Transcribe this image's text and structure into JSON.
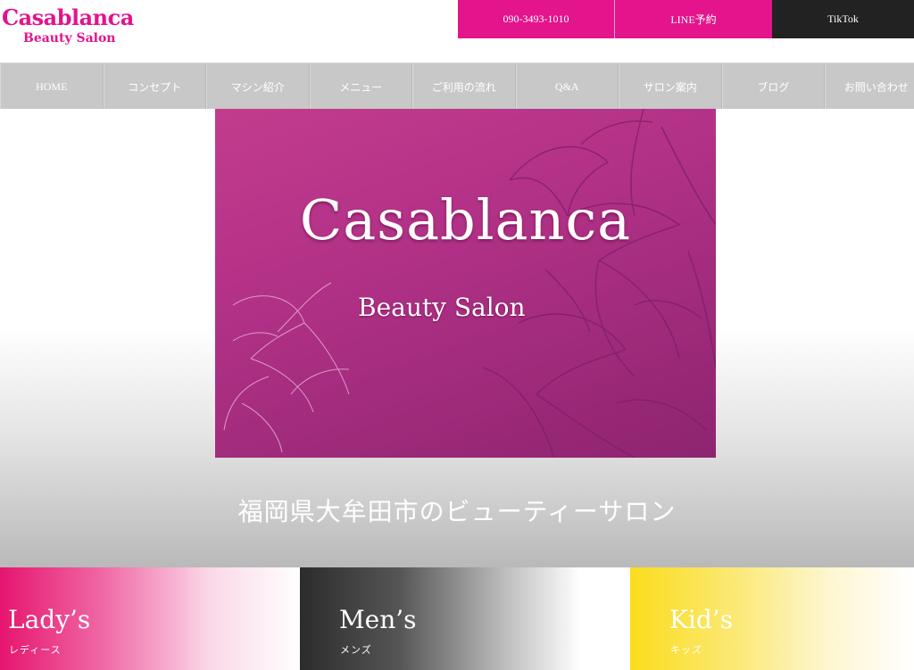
{
  "header": {
    "logo_main": "Casablanca",
    "logo_sub": "Beauty Salon",
    "phone": "090-3493-1010",
    "line": "LINE予約",
    "tiktok": "TikTok"
  },
  "nav": {
    "items": [
      "HOME",
      "コンセプト",
      "マシン紹介",
      "メニュー",
      "ご利用の流れ",
      "Q&A",
      "サロン案内",
      "ブログ",
      "お問い合わせ"
    ]
  },
  "hero": {
    "title": "Casablanca",
    "subtitle": "Beauty Salon",
    "tagline": "福岡県大牟田市のビューティーサロン"
  },
  "cards": [
    {
      "title": "Lady’s",
      "sub": "レディース"
    },
    {
      "title": "Men’s",
      "sub": "メンズ"
    },
    {
      "title": "Kid’s",
      "sub": "キッズ"
    }
  ],
  "colors": {
    "brand": "#e3148c",
    "dark": "#222222",
    "nav_bg": "#c8c8c8",
    "ladies": "#e6156f",
    "mens": "#2c2c2c",
    "kids": "#fbdc1c"
  }
}
